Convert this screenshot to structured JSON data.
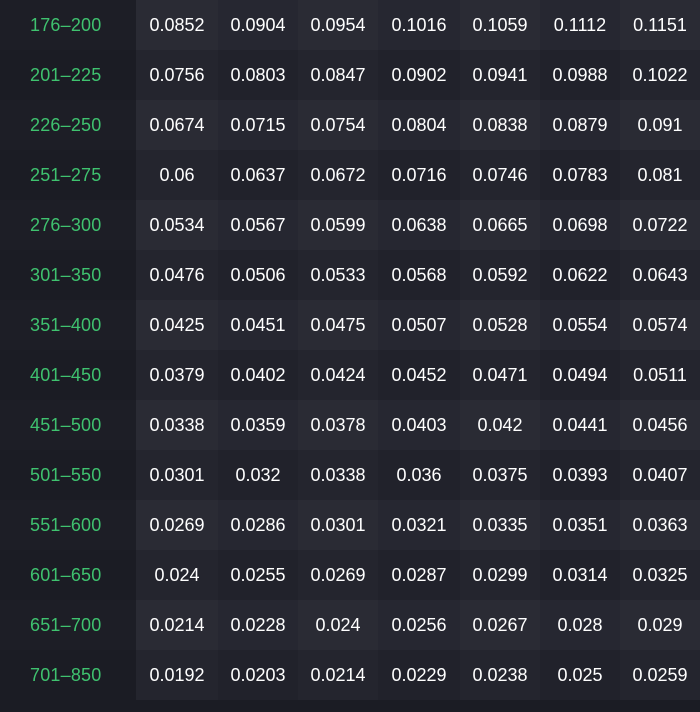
{
  "table": {
    "rows": [
      {
        "range": "176–200",
        "values": [
          "0.0852",
          "0.0904",
          "0.0954",
          "0.1016",
          "0.1059",
          "0.1112",
          "0.1151"
        ]
      },
      {
        "range": "201–225",
        "values": [
          "0.0756",
          "0.0803",
          "0.0847",
          "0.0902",
          "0.0941",
          "0.0988",
          "0.1022"
        ]
      },
      {
        "range": "226–250",
        "values": [
          "0.0674",
          "0.0715",
          "0.0754",
          "0.0804",
          "0.0838",
          "0.0879",
          "0.091"
        ]
      },
      {
        "range": "251–275",
        "values": [
          "0.06",
          "0.0637",
          "0.0672",
          "0.0716",
          "0.0746",
          "0.0783",
          "0.081"
        ]
      },
      {
        "range": "276–300",
        "values": [
          "0.0534",
          "0.0567",
          "0.0599",
          "0.0638",
          "0.0665",
          "0.0698",
          "0.0722"
        ]
      },
      {
        "range": "301–350",
        "values": [
          "0.0476",
          "0.0506",
          "0.0533",
          "0.0568",
          "0.0592",
          "0.0622",
          "0.0643"
        ]
      },
      {
        "range": "351–400",
        "values": [
          "0.0425",
          "0.0451",
          "0.0475",
          "0.0507",
          "0.0528",
          "0.0554",
          "0.0574"
        ]
      },
      {
        "range": "401–450",
        "values": [
          "0.0379",
          "0.0402",
          "0.0424",
          "0.0452",
          "0.0471",
          "0.0494",
          "0.0511"
        ]
      },
      {
        "range": "451–500",
        "values": [
          "0.0338",
          "0.0359",
          "0.0378",
          "0.0403",
          "0.042",
          "0.0441",
          "0.0456"
        ]
      },
      {
        "range": "501–550",
        "values": [
          "0.0301",
          "0.032",
          "0.0338",
          "0.036",
          "0.0375",
          "0.0393",
          "0.0407"
        ]
      },
      {
        "range": "551–600",
        "values": [
          "0.0269",
          "0.0286",
          "0.0301",
          "0.0321",
          "0.0335",
          "0.0351",
          "0.0363"
        ]
      },
      {
        "range": "601–650",
        "values": [
          "0.024",
          "0.0255",
          "0.0269",
          "0.0287",
          "0.0299",
          "0.0314",
          "0.0325"
        ]
      },
      {
        "range": "651–700",
        "values": [
          "0.0214",
          "0.0228",
          "0.024",
          "0.0256",
          "0.0267",
          "0.028",
          "0.029"
        ]
      },
      {
        "range": "701–850",
        "values": [
          "0.0192",
          "0.0203",
          "0.0214",
          "0.0229",
          "0.0238",
          "0.025",
          "0.0259"
        ]
      }
    ]
  },
  "colors": {
    "range_label": "#3fc26f",
    "value_text": "#ffffff",
    "background": "#1b1c24"
  }
}
